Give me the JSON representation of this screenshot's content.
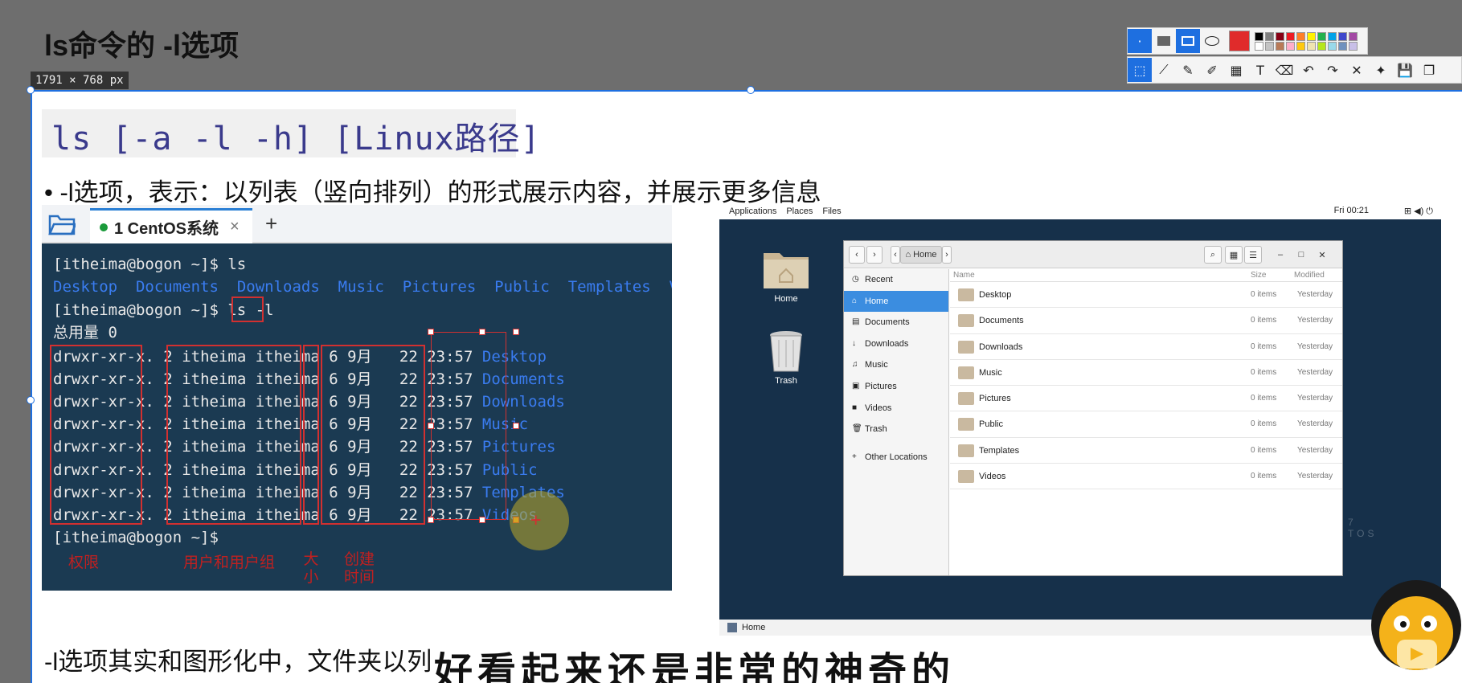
{
  "header": {
    "title": "ls命令的 -l选项",
    "dimensions": "1791 × 768  px"
  },
  "toolbar": {
    "row1_icons": [
      "cursor-icon",
      "rect-filled-icon",
      "rect-outline-icon",
      "ellipse-icon"
    ],
    "row2_icons": [
      "select-icon",
      "polyline-icon",
      "pen-icon",
      "highlighter-icon",
      "mosaic-icon",
      "text-icon",
      "eraser-icon",
      "undo-icon",
      "redo-icon",
      "close-icon",
      "pin-icon",
      "save-icon",
      "copy-icon"
    ],
    "row2_glyphs": [
      "⬚",
      "⟋",
      "✎",
      "✐",
      "▦",
      "T",
      "⌫",
      "↶",
      "↷",
      "✕",
      "✦",
      "💾",
      "❐"
    ],
    "selected_color": "#e02b2b",
    "palette": [
      "#000000",
      "#7f7f7f",
      "#880015",
      "#ed1c24",
      "#ff7f27",
      "#fff200",
      "#22b14c",
      "#00a2e8",
      "#3f48cc",
      "#a349a4",
      "#ffffff",
      "#c3c3c3",
      "#b97a57",
      "#ffaec9",
      "#ffc90e",
      "#efe4b0",
      "#b5e61d",
      "#99d9ea",
      "#7092be",
      "#c8bfe7"
    ]
  },
  "slide": {
    "command": "ls [-a -l -h] [Linux路径]",
    "bullet": "•   -l选项，表示：以列表（竖向排列）的形式展示内容，并展示更多信息",
    "bottom_text": "-l选项其实和图形化中，文件夹以列",
    "subtitle": "好看起来还是非常的神奇的"
  },
  "terminal": {
    "tab_label": "1 CentOS系统",
    "tab_close": "×",
    "new_tab": "+",
    "prompt1": "[itheima@bogon ~]$ ls",
    "ls_output": [
      "Desktop",
      "Documents",
      "Downloads",
      "Music",
      "Pictures",
      "Public",
      "Templates",
      "Videos"
    ],
    "prompt2": "[itheima@bogon ~]$ ls",
    "prompt2_arg": "-l",
    "total": "总用量 0",
    "rows": [
      {
        "perm": "drwxr-xr-x.",
        "links": "2",
        "owner": "itheima itheima",
        "size": "6",
        "date": "9月   22 23:57",
        "name": "Desktop"
      },
      {
        "perm": "drwxr-xr-x.",
        "links": "2",
        "owner": "itheima itheima",
        "size": "6",
        "date": "9月   22 23:57",
        "name": "Documents"
      },
      {
        "perm": "drwxr-xr-x.",
        "links": "2",
        "owner": "itheima itheima",
        "size": "6",
        "date": "9月   22 23:57",
        "name": "Downloads"
      },
      {
        "perm": "drwxr-xr-x.",
        "links": "2",
        "owner": "itheima itheima",
        "size": "6",
        "date": "9月   22 23:57",
        "name": "Music"
      },
      {
        "perm": "drwxr-xr-x.",
        "links": "2",
        "owner": "itheima itheima",
        "size": "6",
        "date": "9月   22 23:57",
        "name": "Pictures"
      },
      {
        "perm": "drwxr-xr-x.",
        "links": "2",
        "owner": "itheima itheima",
        "size": "6",
        "date": "9月   22 23:57",
        "name": "Public"
      },
      {
        "perm": "drwxr-xr-x.",
        "links": "2",
        "owner": "itheima itheima",
        "size": "6",
        "date": "9月   22 23:57",
        "name": "Templates"
      },
      {
        "perm": "drwxr-xr-x.",
        "links": "2",
        "owner": "itheima itheima",
        "size": "6",
        "date": "9月   22 23:57",
        "name": "Videos"
      }
    ],
    "prompt3": "[itheima@bogon ~]$",
    "annotations": {
      "perm": "权限",
      "owner": "用户和用户组",
      "size": "大\n小",
      "date": "创建\n时间"
    }
  },
  "gnome": {
    "topbar": {
      "applications": "Applications",
      "places": "Places",
      "files": "Files",
      "clock": "Fri 00:21",
      "tray_glyphs": "⊞ ◀) ⏻"
    },
    "desktop": {
      "home": "Home",
      "trash": "Trash"
    },
    "bottom_label": "Home",
    "filemanager": {
      "back": "‹",
      "forward": "›",
      "crumb_left": "‹",
      "crumb_right": "›",
      "location": "⌂ Home",
      "search_glyph": "⌕",
      "grid_glyph": "▦",
      "list_glyph": "☰",
      "min_glyph": "–",
      "max_glyph": "□",
      "close_glyph": "✕",
      "columns": {
        "name": "Name",
        "size": "Size",
        "modified": "Modified"
      },
      "sidebar": [
        {
          "icon": "◷",
          "label": "Recent",
          "active": false
        },
        {
          "icon": "⌂",
          "label": "Home",
          "active": true
        },
        {
          "icon": "▤",
          "label": "Documents",
          "active": false
        },
        {
          "icon": "↓",
          "label": "Downloads",
          "active": false
        },
        {
          "icon": "♫",
          "label": "Music",
          "active": false
        },
        {
          "icon": "▣",
          "label": "Pictures",
          "active": false
        },
        {
          "icon": "■",
          "label": "Videos",
          "active": false
        },
        {
          "icon": "🗑",
          "label": "Trash",
          "active": false
        },
        {
          "icon": "+",
          "label": "Other Locations",
          "active": false
        }
      ],
      "files": [
        {
          "name": "Desktop",
          "size": "0 items",
          "modified": "Yesterday"
        },
        {
          "name": "Documents",
          "size": "0 items",
          "modified": "Yesterday"
        },
        {
          "name": "Downloads",
          "size": "0 items",
          "modified": "Yesterday"
        },
        {
          "name": "Music",
          "size": "0 items",
          "modified": "Yesterday"
        },
        {
          "name": "Pictures",
          "size": "0 items",
          "modified": "Yesterday"
        },
        {
          "name": "Public",
          "size": "0 items",
          "modified": "Yesterday"
        },
        {
          "name": "Templates",
          "size": "0 items",
          "modified": "Yesterday"
        },
        {
          "name": "Videos",
          "size": "0 items",
          "modified": "Yesterday"
        }
      ]
    }
  }
}
